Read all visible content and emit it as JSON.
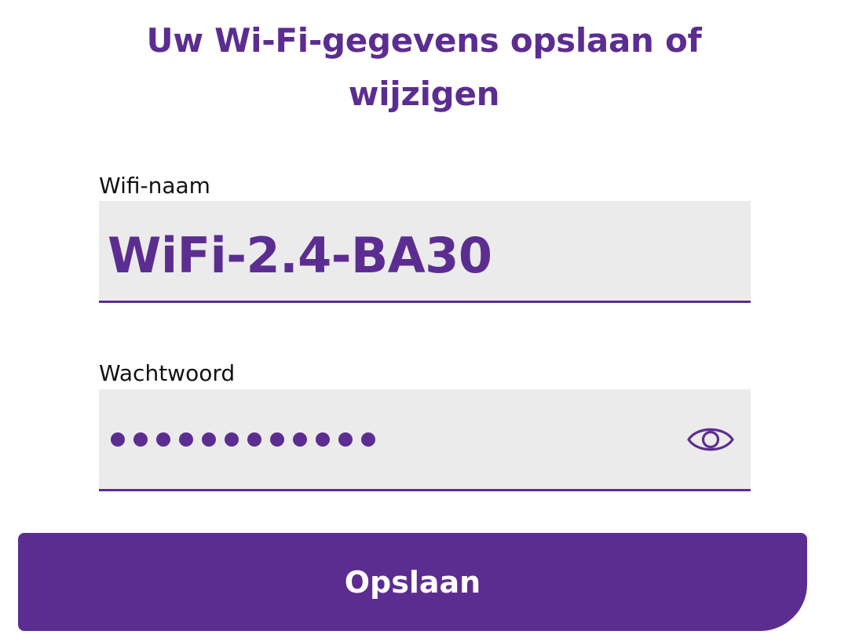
{
  "title": "Uw Wi-Fi-gegevens opslaan of wijzigen",
  "ssid_field": {
    "label": "Wifi-naam",
    "value": "WiFi-2.4-BA30"
  },
  "password_field": {
    "label": "Wachtwoord",
    "masked_length": 12,
    "visibility_icon": "eye-icon"
  },
  "save_button": {
    "label": "Opslaan"
  },
  "colors": {
    "brand": "#5c2d91",
    "field_background": "#ebebeb",
    "label_text": "#111111",
    "button_text": "#ffffff"
  }
}
